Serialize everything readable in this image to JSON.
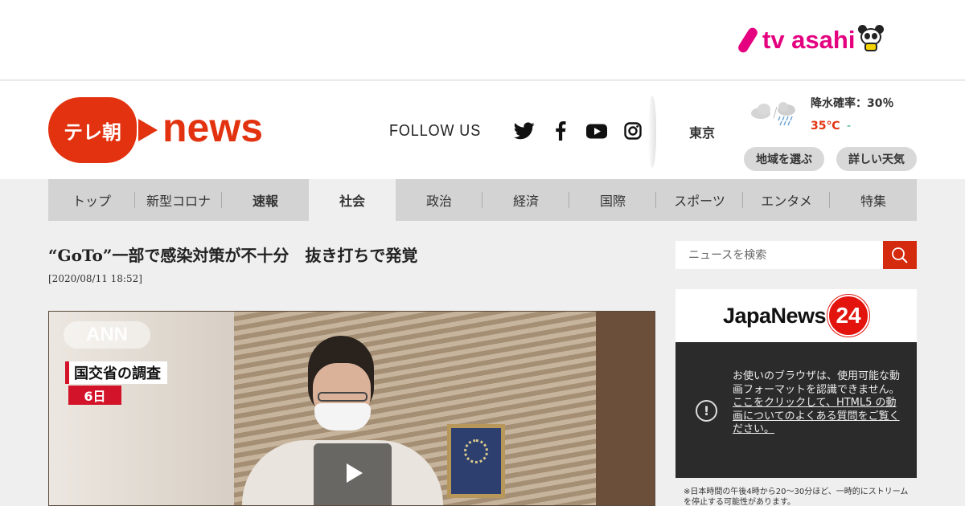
{
  "brand": {
    "tvasahi": "tv asahi",
    "logo_left": "テレ朝",
    "logo_right": "news"
  },
  "social": {
    "follow_label": "FOLLOW US",
    "icons": [
      "twitter-icon",
      "facebook-icon",
      "youtube-icon",
      "instagram-icon"
    ]
  },
  "weather": {
    "city": "東京",
    "rain": "降水確率：30％",
    "temp": "35℃",
    "temp_dash": "-",
    "select_region": "地域を選ぶ",
    "details": "詳しい天気",
    "icon": "cloudy-rain-icon"
  },
  "nav": {
    "items": [
      {
        "label": "トップ"
      },
      {
        "label": "新型コロナ"
      },
      {
        "label": "速報"
      },
      {
        "label": "社会"
      },
      {
        "label": "政治"
      },
      {
        "label": "経済"
      },
      {
        "label": "国際"
      },
      {
        "label": "スポーツ"
      },
      {
        "label": "エンタメ"
      },
      {
        "label": "特集"
      }
    ],
    "active": "社会"
  },
  "article": {
    "title": "“GoTo”一部で感染対策が不十分　抜き打ちで発覚",
    "date": "[2020/08/11 18:52]"
  },
  "video": {
    "watermark": "ANN",
    "caption1": "国交省の調査",
    "caption2": "6日",
    "play_icon": "play-icon"
  },
  "search": {
    "placeholder": "ニュースを検索"
  },
  "japanews": {
    "title": "JapaNews",
    "number": "24",
    "error_text": "お使いのブラウザは、使用可能な動画フォーマットを認識できません。",
    "link_text": "ここをクリックして、HTML5 の動画についてのよくある質問をご覧ください。",
    "note": "※日本時間の午後4時から20～30分ほど、一時的にストリームを停止する可能性があります。"
  },
  "colors": {
    "brand_red": "#e2320f",
    "tvasahi_pink": "#e4007f",
    "search_red": "#d42a0d"
  }
}
